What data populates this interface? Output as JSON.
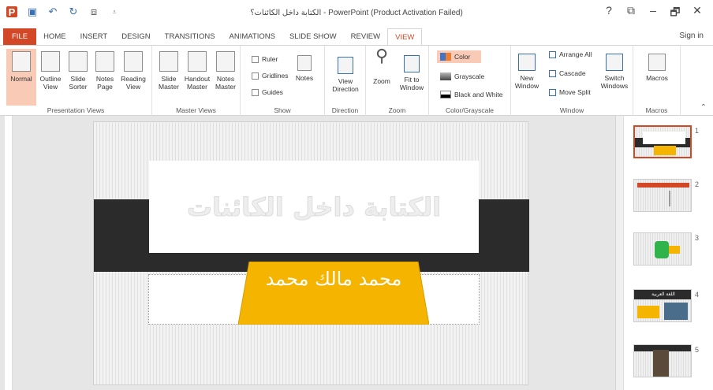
{
  "window": {
    "title": "الكتابة داخل الكائنات؟ - PowerPoint (Product Activation Failed)",
    "controls": [
      "?",
      "⧉",
      "–",
      "🗗",
      "✕"
    ]
  },
  "tabs": [
    "FILE",
    "HOME",
    "INSERT",
    "DESIGN",
    "TRANSITIONS",
    "ANIMATIONS",
    "SLIDE SHOW",
    "REVIEW",
    "VIEW"
  ],
  "active_tab": "VIEW",
  "sign_in": "Sign in",
  "ribbon": {
    "groups": {
      "presentation_views": "Presentation Views",
      "master_views": "Master Views",
      "show": "Show",
      "direction": "Direction",
      "zoom": "Zoom",
      "color_grayscale": "Color/Grayscale",
      "window": "Window",
      "macros": "Macros"
    },
    "buttons": {
      "normal": "Normal",
      "outline_view": "Outline View",
      "slide_sorter": "Slide Sorter",
      "notes_page": "Notes Page",
      "reading_view": "Reading View",
      "slide_master": "Slide Master",
      "handout_master": "Handout Master",
      "notes_master": "Notes Master",
      "ruler": "Ruler",
      "gridlines": "Gridlines",
      "guides": "Guides",
      "notes": "Notes",
      "view_direction": "View Direction",
      "zoom": "Zoom",
      "fit_to_window": "Fit to Window",
      "color": "Color",
      "grayscale": "Grayscale",
      "black_and_white": "Black and White",
      "new_window": "New Window",
      "arrange_all": "Arrange All",
      "cascade": "Cascade",
      "move_split": "Move Split",
      "switch_windows": "Switch Windows",
      "macros": "Macros"
    }
  },
  "slide": {
    "title": "الكتابة داخل الكائنات",
    "subtitle": "محمد مالك محمد"
  },
  "thumbnails": [
    {
      "num": "1"
    },
    {
      "num": "2"
    },
    {
      "num": "3"
    },
    {
      "num": "4",
      "title": "اللغة العربية"
    },
    {
      "num": "5"
    }
  ],
  "colors": {
    "accent": "#d24726",
    "band": "#2b2b2b",
    "trapezoid": "#f5b400"
  }
}
